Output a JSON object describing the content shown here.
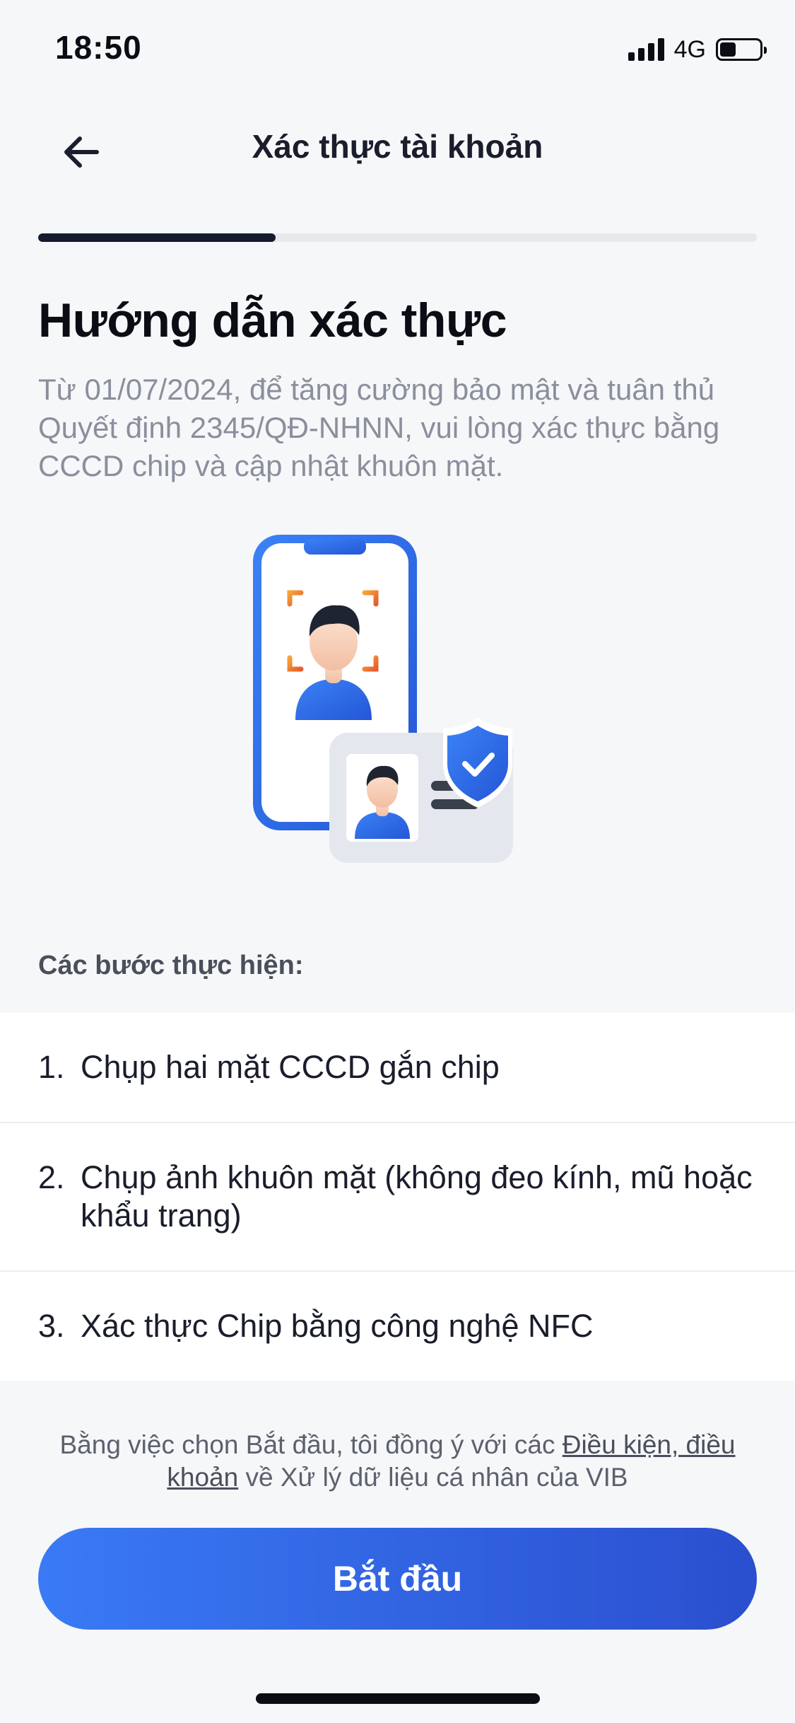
{
  "status_bar": {
    "time": "18:50",
    "network": "4G",
    "signal_bars": 4,
    "battery_level": 0.4
  },
  "header": {
    "title": "Xác thực tài khoản",
    "back_icon": "arrow-left-icon"
  },
  "progress": {
    "fraction": 0.33
  },
  "guide": {
    "heading": "Hướng dẫn xác thực",
    "description": "Từ 01/07/2024, để tăng cường bảo mật và tuân thủ Quyết định 2345/QĐ-NHNN, vui lòng xác thực bằng CCCD chip và cập nhật khuôn mặt."
  },
  "steps": {
    "label": "Các bước thực hiện:",
    "items": [
      {
        "num": "1.",
        "text": "Chụp hai mặt CCCD gắn chip"
      },
      {
        "num": "2.",
        "text": "Chụp ảnh khuôn mặt (không đeo kính, mũ hoặc khẩu trang)"
      },
      {
        "num": "3.",
        "text": "Xác thực Chip bằng công nghệ NFC"
      }
    ]
  },
  "consent": {
    "before": "Bằng việc chọn Bắt đầu, tôi đồng ý với các ",
    "link": "Điều kiện, điều khoản",
    "after": " về Xử lý dữ liệu cá nhân của VIB"
  },
  "start_button": {
    "label": "Bắt đầu"
  },
  "colors": {
    "accent_start": "#3a7af5",
    "accent_end": "#2a4fcf",
    "progress": "#151a2d",
    "background": "#f6f7f9"
  }
}
